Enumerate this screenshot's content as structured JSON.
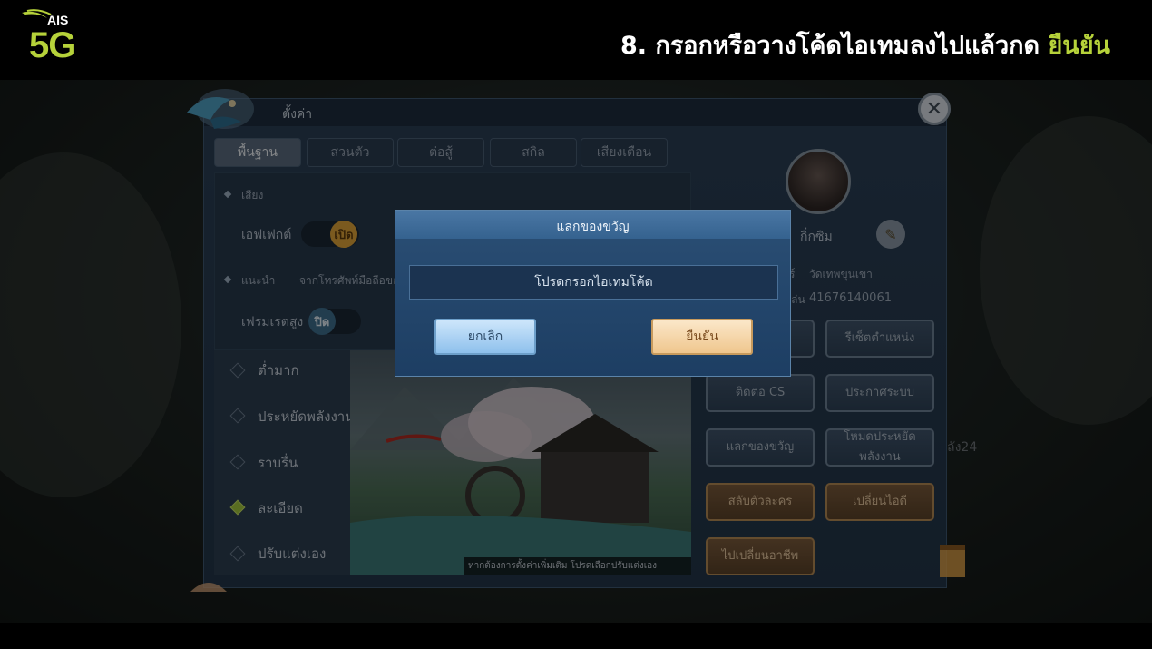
{
  "banner": {
    "logo_text": "AIS",
    "logo_5g": "5G",
    "headline": "8. กรอกหรือวางโค้ดไอเทมลงไปแล้วกด",
    "headline_highlight": "ยืนยัน",
    "highlight_color": "#b6d23a"
  },
  "settings": {
    "title": "ตั้งค่า",
    "tabs": [
      "พื้นฐาน",
      "ส่วนตัว",
      "ต่อสู้",
      "สกิล",
      "เสียงเตือน"
    ],
    "sound_header": "เสียง",
    "effect_label": "เอฟเฟกต์",
    "effect_state": "เปิด",
    "recommend_label": "แนะนำ",
    "recommend_text": "จากโทรศัพท์มือถือของ",
    "fps_label": "เฟรมเรตสูง",
    "fps_state": "ปิด",
    "quality_options": [
      "ต่ำมาก",
      "ประหยัดพลังงาน",
      "ราบรื่น",
      "ละเอียด",
      "ปรับแต่งเอง"
    ],
    "quality_selected": "ละเอียด",
    "scene_note": "หากต้องการตั้งค่าเพิ่มเติม โปรดเลือกปรับแต่งเอง"
  },
  "profile": {
    "name_partial": "กิ่กซิม",
    "server_prefix": "ร์",
    "server": "วัดเทพขุนเขา",
    "id_prefix": "เล่น",
    "player_id": "41676140061",
    "side_text": "ลัง24",
    "buttons": {
      "reset_position": "รีเซ็ตตำแหน่ง",
      "contact_cs": "ติดต่อ CS",
      "announcement": "ประกาศระบบ",
      "redeem_gift": "แลกของขวัญ",
      "power_saving_line1": "โหมดประหยัด",
      "power_saving_line2": "พลังงาน",
      "switch_character": "สลับตัวละคร",
      "change_id": "เปลี่ยนไอดี",
      "change_class": "ไปเปลี่ยนอาชีพ"
    }
  },
  "dialog": {
    "title": "แลกของขวัญ",
    "input_placeholder": "โปรดกรอกไอเทมโค้ด",
    "input_value": "",
    "cancel_label": "ยกเลิก",
    "confirm_label": "ยืนยัน"
  }
}
